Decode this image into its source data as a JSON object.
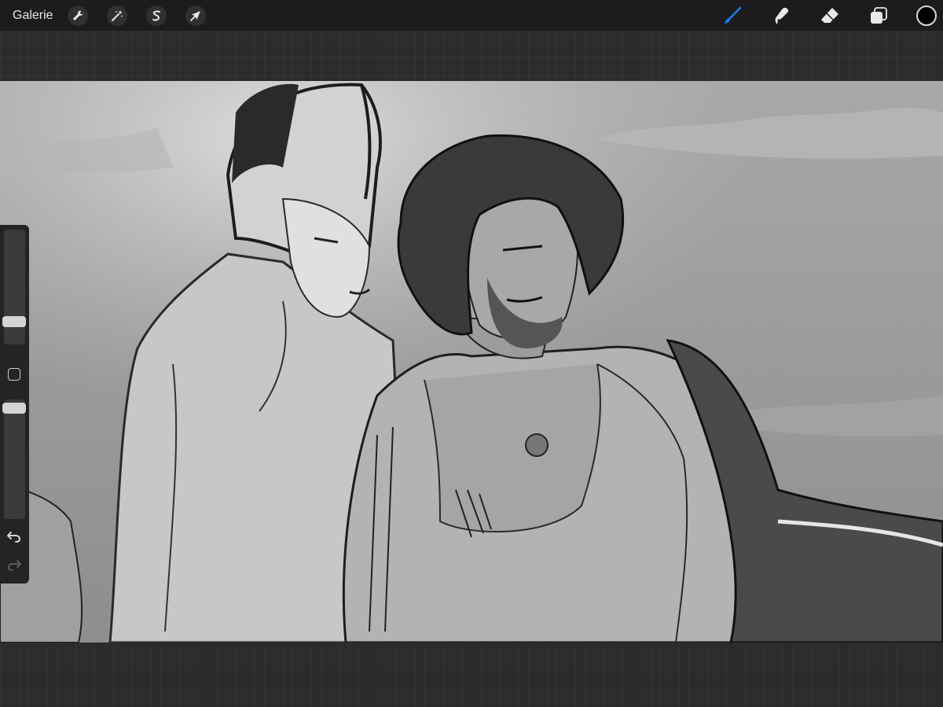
{
  "topbar": {
    "gallery_label": "Galerie",
    "left_tools": [
      {
        "name": "actions",
        "icon": "wrench-icon"
      },
      {
        "name": "adjustments",
        "icon": "magic-wand-icon"
      },
      {
        "name": "selection",
        "icon": "selection-s-icon"
      },
      {
        "name": "transform",
        "icon": "arrow-cursor-icon"
      }
    ],
    "right_tools": [
      {
        "name": "brush",
        "icon": "brush-icon",
        "active": true
      },
      {
        "name": "smudge",
        "icon": "smudge-finger-icon"
      },
      {
        "name": "eraser",
        "icon": "eraser-icon"
      },
      {
        "name": "layers",
        "icon": "layers-icon"
      }
    ],
    "current_color": "#000000",
    "accent_color": "#1a7cf5"
  },
  "sidebar": {
    "brush_size_level": 0.2,
    "opacity_level": 0.97,
    "icons": [
      "modifier-square-icon",
      "undo-icon",
      "redo-icon"
    ]
  },
  "canvas": {
    "content": "grayscale-sketch-artwork"
  }
}
